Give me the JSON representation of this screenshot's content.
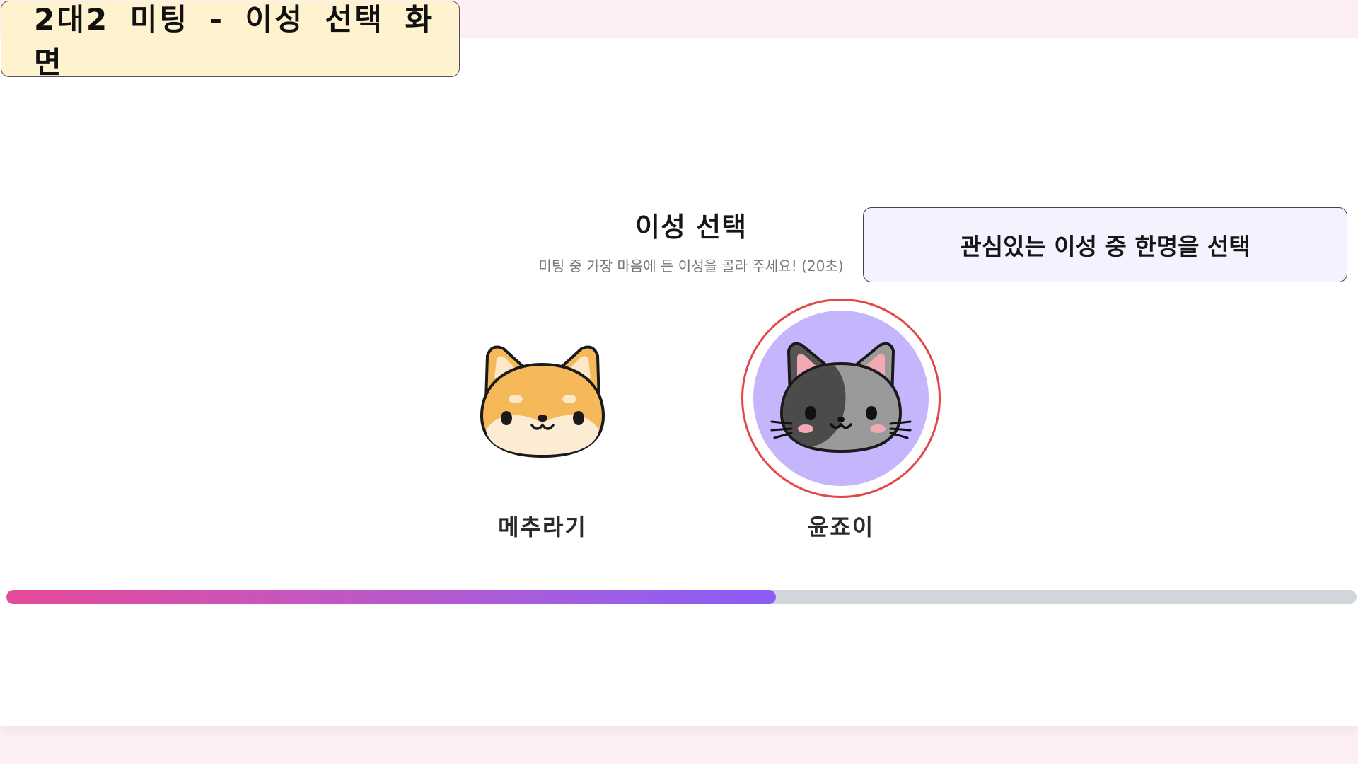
{
  "header": {
    "frame_title": "2대2 미팅 - 이성 선택 화면"
  },
  "selection": {
    "title": "이성 선택",
    "subtitle": "미팅 중 가장 마음에 든 이성을 골라 주세요! (20초)",
    "annotation": "관심있는 이성 중 한명을 선택"
  },
  "candidates": [
    {
      "name": "메추라기",
      "avatar_icon": "shiba-dog-icon",
      "selected": false
    },
    {
      "name": "윤죠이",
      "avatar_icon": "gray-cat-icon",
      "selected": true
    }
  ],
  "timer": {
    "progress": 0.57
  },
  "colors": {
    "page_bg": "#fdeff5",
    "frame_title_bg": "#fff3cf",
    "annotation_bg": "#f6f1fe",
    "selected_ring": "#e34747",
    "selected_fill": "#c4b5fd",
    "progress_start": "#e64a99",
    "progress_end": "#8b5cf6",
    "progress_track": "#d3d5dc"
  }
}
